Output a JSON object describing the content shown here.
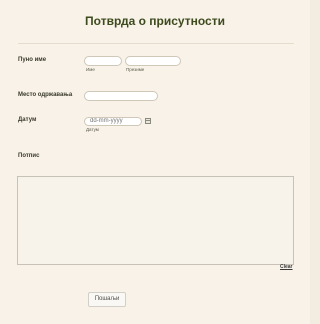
{
  "form": {
    "title": "Потврда о присутности",
    "full_name": {
      "label": "Пуно име",
      "first_sublabel": "Име",
      "last_sublabel": "Презиме",
      "first_value": "",
      "last_value": ""
    },
    "residence": {
      "label": "Место одржавања",
      "value": ""
    },
    "date": {
      "label": "Датум",
      "placeholder": "dd-mm-yyyy",
      "sublabel": "Датум",
      "icon": "calendar-icon"
    },
    "signature": {
      "label": "Потпис",
      "clear_label": "Clear"
    },
    "submit_label": "Пошаљи"
  }
}
